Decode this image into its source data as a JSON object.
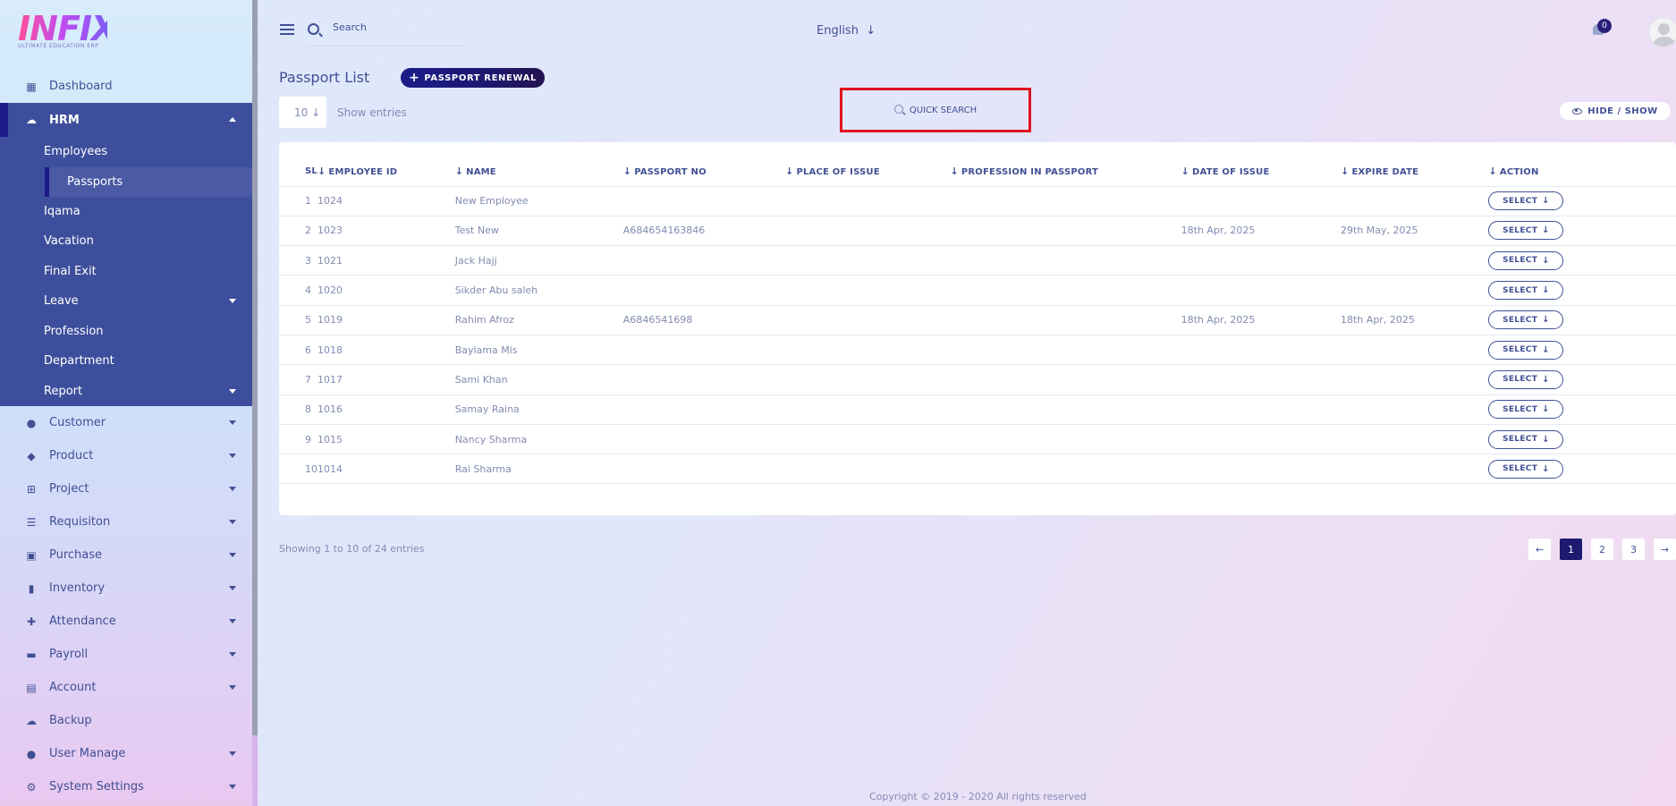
{
  "logo": {
    "text": "INFIX",
    "subtitle": "ULTIMATE EDUCATION ERP"
  },
  "sidebar": {
    "dashboard": "Dashboard",
    "hrm": {
      "label": "HRM",
      "children": [
        "Employees"
      ],
      "active_child": "Passports",
      "rest": [
        "Iqama",
        "Vacation",
        "Final Exit",
        "Leave",
        "Profession",
        "Department",
        "Report"
      ]
    },
    "items": [
      "Customer",
      "Product",
      "Project",
      "Requisiton",
      "Purchase",
      "Inventory",
      "Attendance",
      "Payroll",
      "Account",
      "Backup",
      "User Manage",
      "System Settings"
    ]
  },
  "header": {
    "search_placeholder": "Search",
    "language": "English",
    "notification_count": "0"
  },
  "page": {
    "title": "Passport List",
    "renew_label": "PASSPORT RENEWAL",
    "entries_value": "10",
    "entries_label": "Show entries",
    "quick_search": "QUICK SEARCH",
    "hide_show": "HIDE / SHOW"
  },
  "table": {
    "columns": [
      "SL",
      "EMPLOYEE ID",
      "NAME",
      "PASSPORT NO",
      "PLACE OF ISSUE",
      "PROFESSION IN PASSPORT",
      "DATE OF ISSUE",
      "EXPIRE DATE",
      "ACTION"
    ],
    "action_label": "SELECT",
    "rows": [
      [
        "1",
        "1024",
        "New Employee",
        "",
        "",
        "",
        "",
        ""
      ],
      [
        "2",
        "1023",
        "Test New",
        "A684654163846",
        "",
        "",
        "18th Apr, 2025",
        "29th May, 2025"
      ],
      [
        "3",
        "1021",
        "Jack Hajj",
        "",
        "",
        "",
        "",
        ""
      ],
      [
        "4",
        "1020",
        "Sikder Abu saleh",
        "",
        "",
        "",
        "",
        ""
      ],
      [
        "5",
        "1019",
        "Rahim Afroz",
        "A6846541698",
        "",
        "",
        "18th Apr, 2025",
        "18th Apr, 2025"
      ],
      [
        "6",
        "1018",
        "Baylama Mis",
        "",
        "",
        "",
        "",
        ""
      ],
      [
        "7",
        "1017",
        "Sami Khan",
        "",
        "",
        "",
        "",
        ""
      ],
      [
        "8",
        "1016",
        "Samay Raina",
        "",
        "",
        "",
        "",
        ""
      ],
      [
        "9",
        "1015",
        "Nancy Sharma",
        "",
        "",
        "",
        "",
        ""
      ],
      [
        "10",
        "1014",
        "Rai Sharma",
        "",
        "",
        "",
        "",
        ""
      ]
    ]
  },
  "footer": {
    "showing": "Showing 1 to 10 of 24 entries",
    "pages": [
      "1",
      "2",
      "3"
    ],
    "prev": "←",
    "next": "→",
    "copyright": "Copyright © 2019 - 2020 All rights reserved"
  }
}
